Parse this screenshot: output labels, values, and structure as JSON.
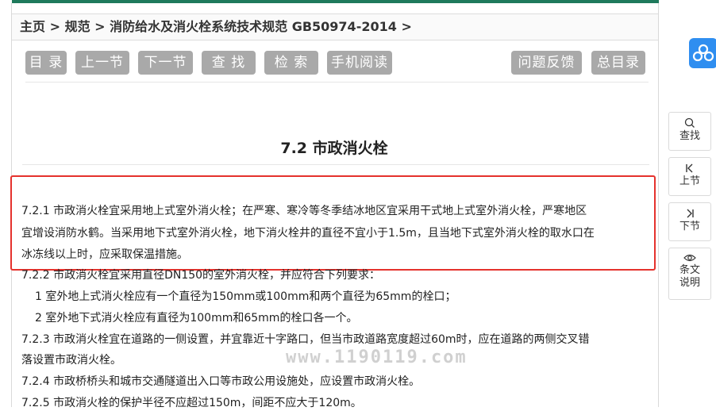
{
  "breadcrumb": {
    "home": "主页",
    "sep1": " > ",
    "category": "规范",
    "sep2": " > ",
    "document": "消防给水及消火栓系统技术规范 GB50974-2014",
    "sep3": " >"
  },
  "toolbar": {
    "toc": "目 录",
    "prev": "上一节",
    "next": "下一节",
    "find": "查 找",
    "search": "检 索",
    "mobile": "手机阅读",
    "feedback": "问题反馈",
    "master_toc": "总目录"
  },
  "section": {
    "title": "7.2  市政消火栓"
  },
  "content": {
    "p1_line1": "7.2.1 市政消火栓宜采用地上式室外消火栓；在严寒、寒冷等冬季结冰地区宜采用干式地上式室外消火栓，严寒地区",
    "p1_line2": "宜增设消防水鹤。当采用地下式室外消火栓，地下消火栓井的直径不宜小于1.5m，且当地下式室外消火栓的取水口在",
    "p1_line3": "冰冻线以上时，应采取保温措施。",
    "p2": "7.2.2 市政消火栓宜采用直径DN150的室外消火栓，并应符合下列要求：",
    "p2_item1": "1 室外地上式消火栓应有一个直径为150mm或100mm和两个直径为65mm的栓口；",
    "p2_item2": "2 室外地下式消火栓应有直径为100mm和65mm的栓口各一个。",
    "p3_line1": "7.2.3 市政消火栓宜在道路的一侧设置，并宜靠近十字路口，但当市政道路宽度超过60m时，应在道路的两侧交叉错",
    "p3_line2": "落设置市政消火栓。",
    "p4": "7.2.4 市政桥桥头和城市交通隧道出入口等市政公用设施处，应设置市政消火栓。",
    "p5": "7.2.5 市政消火栓的保护半径不应超过150m，间距不应大于120m。"
  },
  "watermark": "www.1190119.com",
  "sidebar": {
    "find": "查找",
    "prev": "上节",
    "next": "下节",
    "explain_line1": "条文",
    "explain_line2": "说明"
  },
  "colors": {
    "accent": "#1f7a5c",
    "button": "#a9a9a9",
    "highlight_border": "#e5322d",
    "floating_icon": "#2f8ef0"
  },
  "icons": [
    "search-icon",
    "skip-back-icon",
    "skip-forward-icon",
    "eye-icon",
    "baidu-icon"
  ]
}
